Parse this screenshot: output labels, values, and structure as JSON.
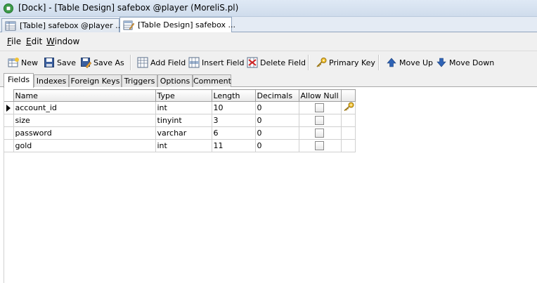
{
  "window": {
    "title": "[Dock] - [Table Design] safebox @player (MoreliS.pl)"
  },
  "doc_tabs": [
    {
      "label": "[Table] safebox @player ..."
    },
    {
      "label": "[Table Design] safebox ..."
    }
  ],
  "menu": {
    "file": "ile",
    "edit": "dit",
    "window": "indow",
    "file_key": "F",
    "edit_key": "E",
    "window_key": "W"
  },
  "toolbar": {
    "new": "New",
    "save": "Save",
    "save_as": "Save As",
    "add_field": "Add Field",
    "insert_field": "Insert Field",
    "delete_field": "Delete Field",
    "primary_key": "Primary Key",
    "move_up": "Move Up",
    "move_down": "Move Down"
  },
  "tabs": [
    "Fields",
    "Indexes",
    "Foreign Keys",
    "Triggers",
    "Options",
    "Comment"
  ],
  "grid": {
    "columns": [
      "Name",
      "Type",
      "Length",
      "Decimals",
      "Allow Null"
    ],
    "rows": [
      {
        "name": "account_id",
        "type": "int",
        "length": "10",
        "decimals": "0",
        "allow_null": false,
        "primary_key": true
      },
      {
        "name": "size",
        "type": "tinyint",
        "length": "3",
        "decimals": "0",
        "allow_null": false,
        "primary_key": false
      },
      {
        "name": "password",
        "type": "varchar",
        "length": "6",
        "decimals": "0",
        "allow_null": false,
        "primary_key": false
      },
      {
        "name": "gold",
        "type": "int",
        "length": "11",
        "decimals": "0",
        "allow_null": false,
        "primary_key": false
      }
    ]
  }
}
